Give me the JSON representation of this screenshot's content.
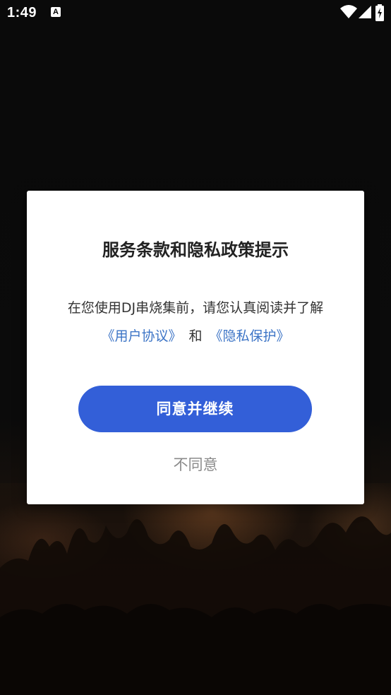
{
  "status_bar": {
    "time": "1:49",
    "notification_icon": "A",
    "icons": [
      "wifi-icon",
      "signal-icon",
      "battery-charging-icon"
    ]
  },
  "dialog": {
    "title": "服务条款和隐私政策提示",
    "body_text": "在您使用DJ串烧集前，请您认真阅读并了解",
    "user_agreement_link": "《用户协议》",
    "conjunction": "和",
    "privacy_link": "《隐私保护》",
    "agree_button": "同意并继续",
    "decline_button": "不同意"
  },
  "colors": {
    "accent": "#335fd8",
    "link": "#3c74c6",
    "background": "#0b0b0b",
    "dialog_bg": "#ffffff"
  }
}
